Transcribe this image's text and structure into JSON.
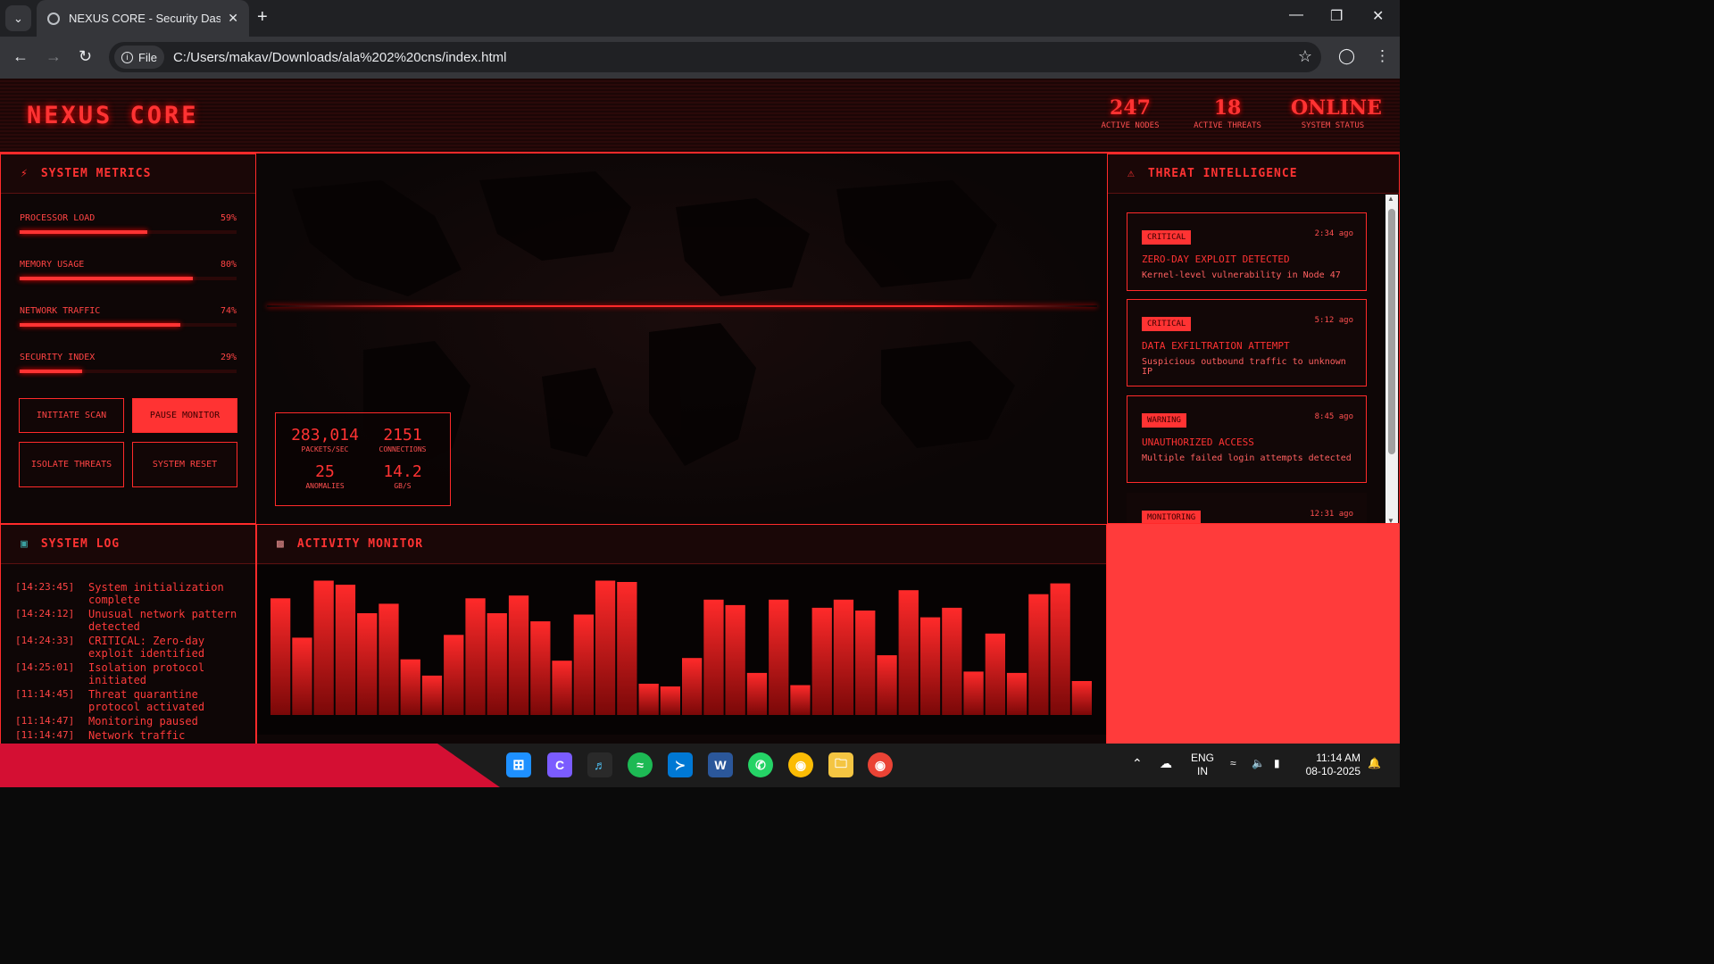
{
  "browser": {
    "tab_title": "NEXUS CORE - Security Dashbo",
    "url": "C:/Users/makav/Downloads/ala%202%20cns/index.html",
    "file_chip": "File"
  },
  "header": {
    "brand": "NEXUS CORE",
    "stats": [
      {
        "value": "247",
        "label": "ACTIVE NODES"
      },
      {
        "value": "18",
        "label": "ACTIVE THREATS"
      },
      {
        "value": "ONLINE",
        "label": "SYSTEM STATUS"
      }
    ]
  },
  "metrics_panel": {
    "title": "SYSTEM METRICS",
    "metrics": [
      {
        "label": "PROCESSOR LOAD",
        "value": "59%",
        "level": 0.59
      },
      {
        "label": "MEMORY USAGE",
        "value": "80%",
        "level": 0.8
      },
      {
        "label": "NETWORK TRAFFIC",
        "value": "74%",
        "level": 0.74
      },
      {
        "label": "SECURITY INDEX",
        "value": "29%",
        "level": 0.29
      }
    ],
    "buttons": {
      "scan": "INITIATE SCAN",
      "pause": "PAUSE MONITOR",
      "isolate": "ISOLATE THREATS",
      "reset": "SYSTEM RESET"
    }
  },
  "network_stats": {
    "packets": {
      "value": "283,014",
      "label": "PACKETS/SEC"
    },
    "connections": {
      "value": "2151",
      "label": "CONNECTIONS"
    },
    "anomalies": {
      "value": "25",
      "label": "ANOMALIES"
    },
    "throughput": {
      "value": "14.2",
      "label": "GB/S"
    }
  },
  "threat_panel": {
    "title": "THREAT INTELLIGENCE",
    "threats": [
      {
        "badge": "CRITICAL",
        "time": "2:34 ago",
        "title": "ZERO-DAY EXPLOIT DETECTED",
        "desc": "Kernel-level vulnerability in Node 47"
      },
      {
        "badge": "CRITICAL",
        "time": "5:12 ago",
        "title": "DATA EXFILTRATION ATTEMPT",
        "desc": "Suspicious outbound traffic to unknown IP"
      },
      {
        "badge": "WARNING",
        "time": "8:45 ago",
        "title": "UNAUTHORIZED ACCESS",
        "desc": "Multiple failed login attempts detected"
      },
      {
        "badge": "MONITORING",
        "time": "12:31 ago",
        "title": "",
        "desc": ""
      }
    ]
  },
  "log_panel": {
    "title": "SYSTEM LOG",
    "entries": [
      {
        "ts": "[14:23:45]",
        "msg": "System initialization complete"
      },
      {
        "ts": "[14:24:12]",
        "msg": "Unusual network pattern detected"
      },
      {
        "ts": "[14:24:33]",
        "msg": "CRITICAL: Zero-day exploit identified"
      },
      {
        "ts": "[14:25:01]",
        "msg": "Isolation protocol initiated"
      },
      {
        "ts": "[11:14:45]",
        "msg": "Threat quarantine protocol activated"
      },
      {
        "ts": "[11:14:47]",
        "msg": "Monitoring paused"
      },
      {
        "ts": "[11:14:47]",
        "msg": "Network traffic"
      }
    ]
  },
  "activity_panel": {
    "title": "ACTIVITY MONITOR"
  },
  "chart_data": {
    "type": "bar",
    "values": [
      86,
      57,
      99,
      96,
      75,
      82,
      41,
      29,
      59,
      86,
      75,
      88,
      69,
      40,
      74,
      99,
      98,
      23,
      21,
      42,
      85,
      81,
      31,
      85,
      22,
      79,
      85,
      77,
      44,
      92,
      72,
      79,
      32,
      60,
      31,
      89,
      97,
      25
    ],
    "ylim": [
      0,
      100
    ]
  },
  "taskbar": {
    "lang": "ENG",
    "region": "IN",
    "time": "11:14 AM",
    "date": "08-10-2025"
  },
  "colors": {
    "accent": "#ff3333",
    "background": "#0a0505",
    "taskbar_red": "#d40f33"
  }
}
